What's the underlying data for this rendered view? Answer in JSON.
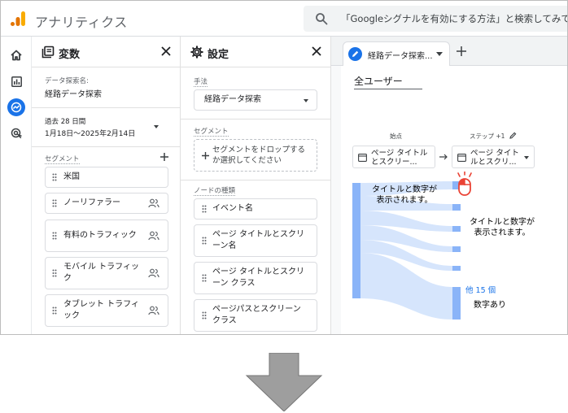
{
  "app": {
    "title": "アナリティクス",
    "search_placeholder": "「Googleシグナルを有効にする方法」と検索してみてく"
  },
  "rail": {
    "items": [
      "home-icon",
      "reports-icon",
      "explore-icon",
      "advertising-icon"
    ],
    "active_index": 2
  },
  "variables": {
    "title": "変数",
    "exploration_name_label": "データ探索名:",
    "exploration_name": "経路データ探索",
    "date_range_label": "過去 28 日間",
    "date_range": "1月18日〜2025年2月14日",
    "segments_label": "セグメント",
    "segments": [
      {
        "label": "米国",
        "icon": false
      },
      {
        "label": "ノーリファラー",
        "icon": true
      },
      {
        "label": "有料のトラフィック",
        "icon": true
      },
      {
        "label": "モバイル トラフィック",
        "icon": true
      },
      {
        "label": "タブレット トラフィック",
        "icon": true
      }
    ]
  },
  "settings": {
    "title": "設定",
    "technique_label": "手法",
    "technique_value": "経路データ探索",
    "segment_label": "セグメント",
    "segment_drop_text": "セグメントをドロップするか選択してください",
    "node_type_label": "ノードの種類",
    "node_types": [
      "イベント名",
      "ページ タイトルとスクリーン名",
      "ページ タイトルとスクリーン クラス",
      "ページパスとスクリーン クラス"
    ]
  },
  "canvas": {
    "tab_label": "経路データ探索...",
    "segment_title": "全ユーザー",
    "start_label": "始点",
    "step_label": "ステップ +1",
    "start_node": "ページ タイトルとスクリー...",
    "step_node": "ページ タイトルとスクリ...",
    "annotation_1": "タイトルと数字が 表示されます。",
    "annotation_2": "タイトルと数字が 表示されます。",
    "more_label": "他 15 個",
    "annotation_3": "数字あり"
  },
  "colors": {
    "accent": "#1a73e8",
    "flow_bar": "#8ab4f8",
    "flow_link": "#d2e3fc",
    "click_icon": "#ea4335",
    "arrow": "#9e9e9e"
  }
}
